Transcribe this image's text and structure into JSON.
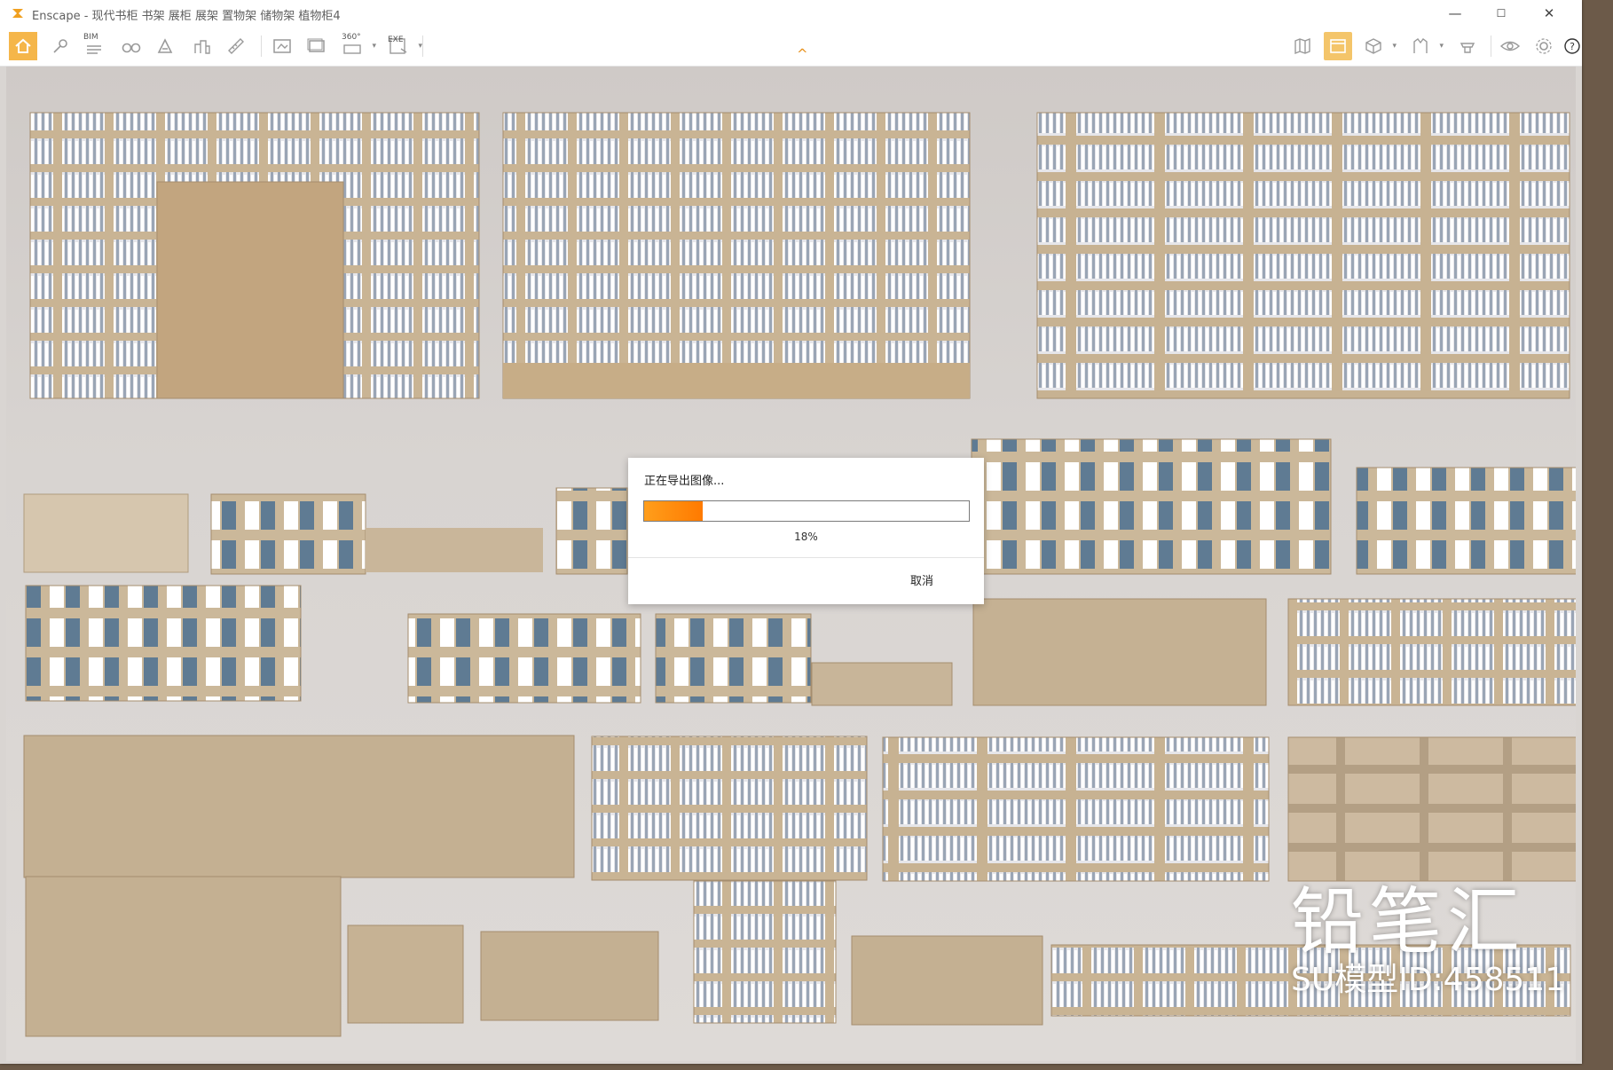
{
  "window": {
    "app_name": "Enscape",
    "title": "Enscape - 现代书柜 书架 展柜 展架 置物架 储物架 植物柜4",
    "controls": {
      "minimize": "—",
      "maximize": "☐",
      "close": "✕"
    }
  },
  "toolbar": {
    "bim_label": "BIM",
    "pano_label": "360°",
    "exe_label": "EXE",
    "icons": [
      "home-icon",
      "pin-icon",
      "bim-icon",
      "binoculars-icon",
      "asset-icon",
      "city-icon",
      "measure-icon",
      "render-icon",
      "batch-render-icon",
      "panorama-icon",
      "export-exe-icon",
      "map-icon",
      "views-icon",
      "cube-icon",
      "materials-icon",
      "sync-icon",
      "vr-icon",
      "settings-icon",
      "help-icon"
    ]
  },
  "dialog": {
    "title": "正在导出图像...",
    "progress_percent": 18,
    "progress_text": "18%",
    "cancel_label": "取消"
  },
  "watermark": {
    "brand": "铅笔汇",
    "model_id": "SU模型ID:458511"
  },
  "colors": {
    "accent": "#f5b64a",
    "progress": "#ff8a00",
    "wood": "#cdb89b"
  }
}
